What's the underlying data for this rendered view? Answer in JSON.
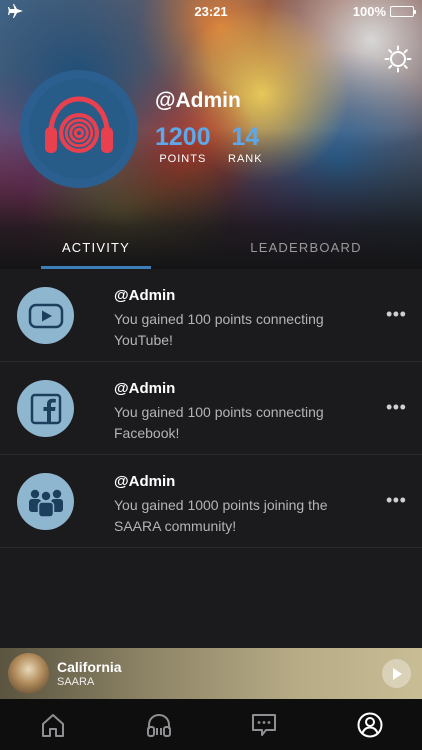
{
  "status_bar": {
    "time": "23:21",
    "battery": "100%"
  },
  "profile": {
    "username": "@Admin",
    "points_value": "1200",
    "points_label": "POINTS",
    "rank_value": "14",
    "rank_label": "RANK"
  },
  "tabs": [
    {
      "label": "ACTIVITY",
      "active": true
    },
    {
      "label": "LEADERBOARD",
      "active": false
    }
  ],
  "feed": [
    {
      "user": "@Admin",
      "text": "You gained 100 points connecting YouTube!",
      "icon": "youtube-icon",
      "more": "•••"
    },
    {
      "user": "@Admin",
      "text": "You gained 100 points connecting Facebook!",
      "icon": "facebook-icon",
      "more": "•••"
    },
    {
      "user": "@Admin",
      "text": "You gained 1000 points joining the SAARA community!",
      "icon": "community-icon",
      "more": "•••"
    }
  ],
  "now_playing": {
    "title": "California",
    "artist": "SAARA"
  },
  "colors": {
    "accent": "#5ea7e8",
    "tab_underline": "#3c7fb8",
    "avatar_bg": "#2a5f8f",
    "headphones": "#e8404f"
  },
  "bottom_nav": [
    "home-icon",
    "headphones-icon",
    "chat-icon",
    "profile-icon"
  ]
}
